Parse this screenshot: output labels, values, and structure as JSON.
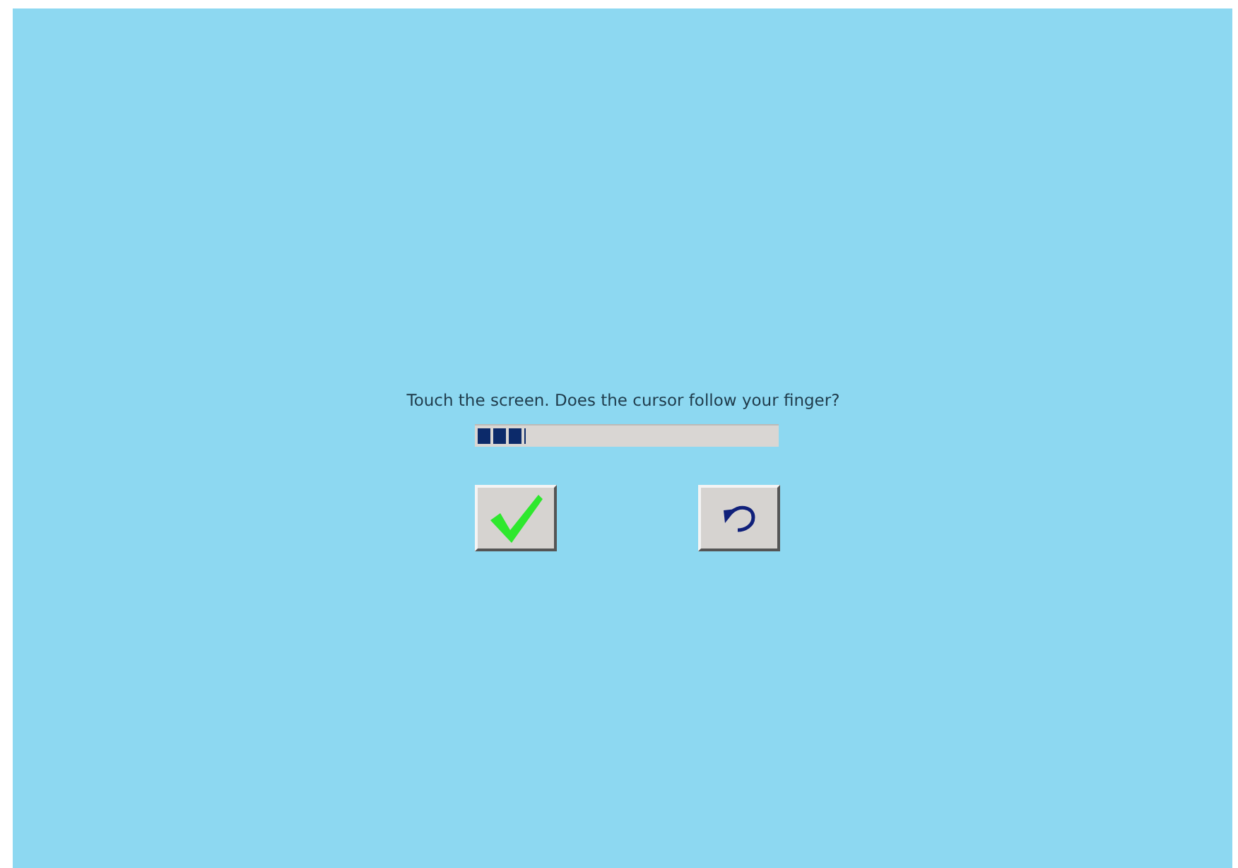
{
  "prompt": "Touch the screen. Does the cursor follow your finger?",
  "progress": {
    "level": 0.16
  },
  "buttons": [
    {
      "kind": "confirm"
    },
    {
      "kind": "retry"
    }
  ]
}
